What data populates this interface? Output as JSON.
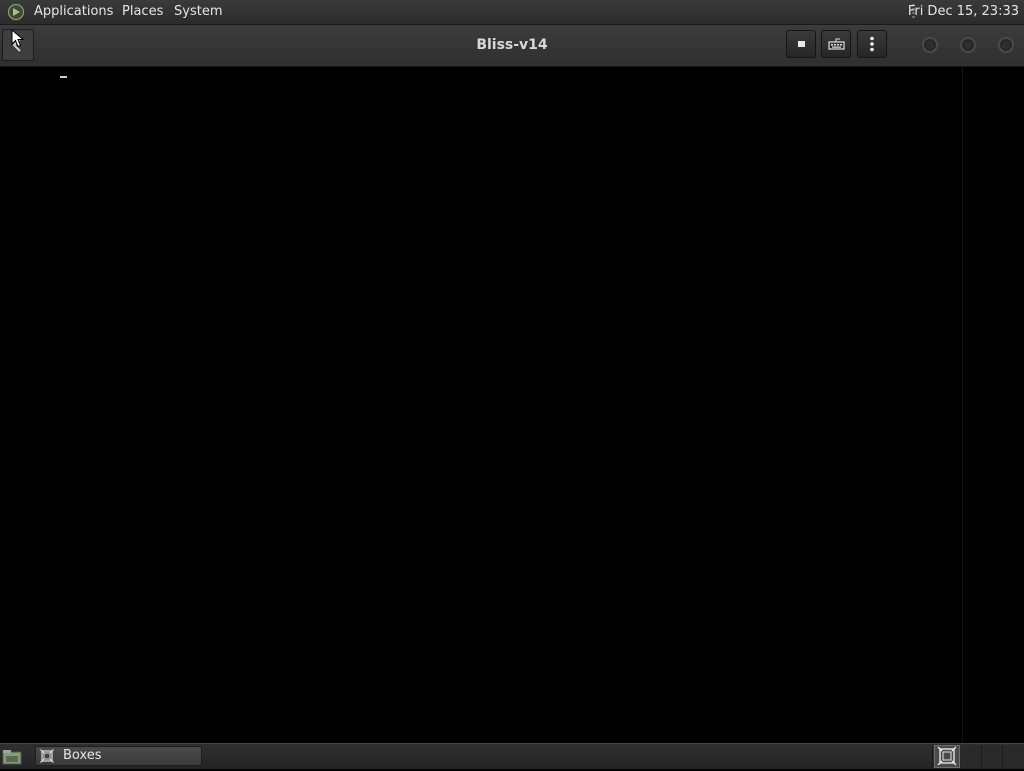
{
  "top_panel": {
    "menu": {
      "applications": "Applications",
      "places": "Places",
      "system": "System"
    },
    "clock": "Fri Dec 15, 23:33"
  },
  "window": {
    "title": "Bliss-v14",
    "header_buttons": {
      "back": "back-icon",
      "stop": "stop-icon",
      "keyboard": "keyboard-icon",
      "menu": "vertical-ellipsis-icon"
    },
    "controls": [
      "minimize",
      "maximize",
      "close"
    ]
  },
  "vm_display": {
    "content": "console-cursor"
  },
  "bottom_panel": {
    "taskbar": [
      {
        "label": "Boxes",
        "icon": "boxes-icon",
        "active": true
      }
    ],
    "workspaces": {
      "count": 4,
      "active": 1
    }
  },
  "colors": {
    "panel_bg": "#2b2b2b",
    "header_bg": "#333333",
    "text": "#e6e6e6",
    "title_text": "#d8d8d8",
    "display_bg": "#000000"
  }
}
